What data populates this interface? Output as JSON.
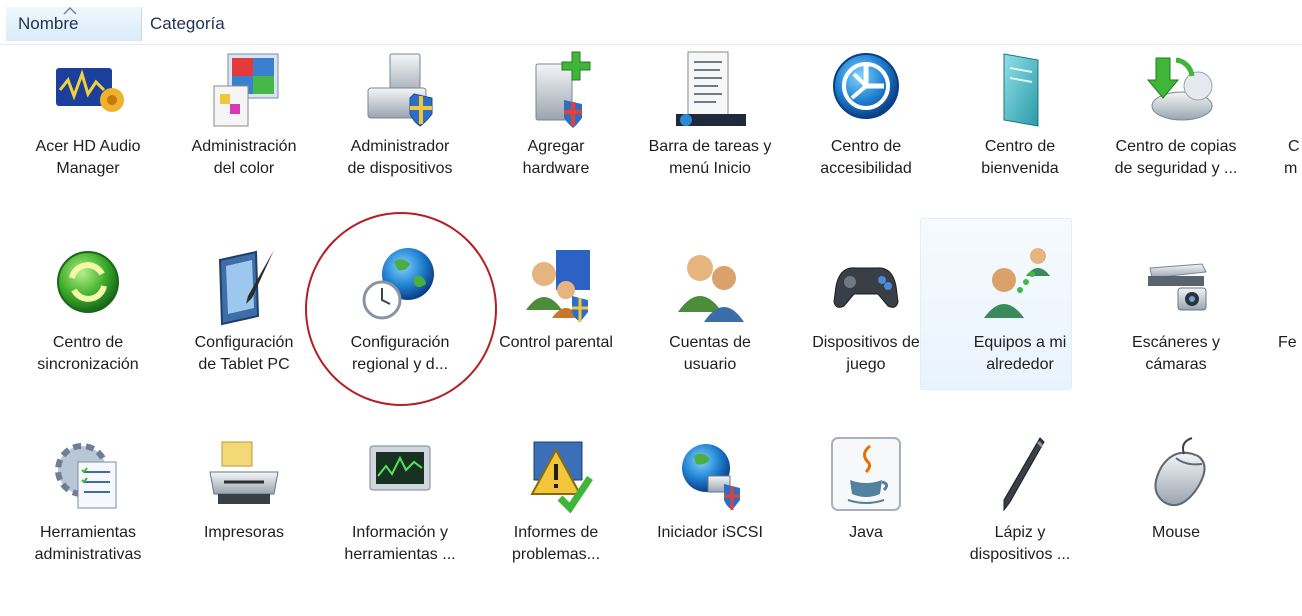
{
  "header": {
    "columns": [
      {
        "label": "Nombre"
      },
      {
        "label": "Categoría"
      }
    ]
  },
  "rows": [
    [
      {
        "line1": "Acer HD Audio",
        "line2": "Manager",
        "icon": "audio-manager-icon"
      },
      {
        "line1": "Administración",
        "line2": "del color",
        "icon": "color-management-icon"
      },
      {
        "line1": "Administrador",
        "line2": "de dispositivos",
        "icon": "device-manager-icon"
      },
      {
        "line1": "Agregar",
        "line2": "hardware",
        "icon": "add-hardware-icon"
      },
      {
        "line1": "Barra de tareas y",
        "line2": "menú Inicio",
        "icon": "taskbar-icon"
      },
      {
        "line1": "Centro de",
        "line2": "accesibilidad",
        "icon": "accessibility-icon"
      },
      {
        "line1": "Centro de",
        "line2": "bienvenida",
        "icon": "welcome-center-icon"
      },
      {
        "line1": "Centro de copias",
        "line2": "de seguridad y ...",
        "icon": "backup-center-icon"
      }
    ],
    [
      {
        "line1": "Centro de",
        "line2": "sincronización",
        "icon": "sync-center-icon"
      },
      {
        "line1": "Configuración",
        "line2": "de Tablet PC",
        "icon": "tablet-pc-icon"
      },
      {
        "line1": "Configuración",
        "line2": "regional y d...",
        "icon": "regional-settings-icon"
      },
      {
        "line1": "Control parental",
        "line2": "",
        "icon": "parental-control-icon"
      },
      {
        "line1": "Cuentas de",
        "line2": "usuario",
        "icon": "user-accounts-icon"
      },
      {
        "line1": "Dispositivos de",
        "line2": "juego",
        "icon": "gamepad-icon"
      },
      {
        "line1": "Equipos a mi",
        "line2": "alrededor",
        "icon": "people-near-me-icon"
      },
      {
        "line1": "Escáneres y",
        "line2": "cámaras",
        "icon": "scanner-camera-icon"
      }
    ],
    [
      {
        "line1": "Herramientas",
        "line2": "administrativas",
        "icon": "admin-tools-icon"
      },
      {
        "line1": "Impresoras",
        "line2": "",
        "icon": "printers-icon"
      },
      {
        "line1": "Información y",
        "line2": "herramientas ...",
        "icon": "performance-info-icon"
      },
      {
        "line1": "Informes de",
        "line2": "problemas...",
        "icon": "problem-reports-icon"
      },
      {
        "line1": "Iniciador iSCSI",
        "line2": "",
        "icon": "iscsi-initiator-icon"
      },
      {
        "line1": "Java",
        "line2": "",
        "icon": "java-icon"
      },
      {
        "line1": "Lápiz y",
        "line2": "dispositivos ...",
        "icon": "pen-devices-icon"
      },
      {
        "line1": "Mouse",
        "line2": "",
        "icon": "mouse-icon"
      }
    ]
  ],
  "partial": {
    "row1_line1": "C",
    "row1_line2": "m",
    "row2": "Fe"
  },
  "colors": {
    "highlight": "#e9f3fd",
    "circle": "#b51f24",
    "header_sorted": "#d9ebfa"
  }
}
